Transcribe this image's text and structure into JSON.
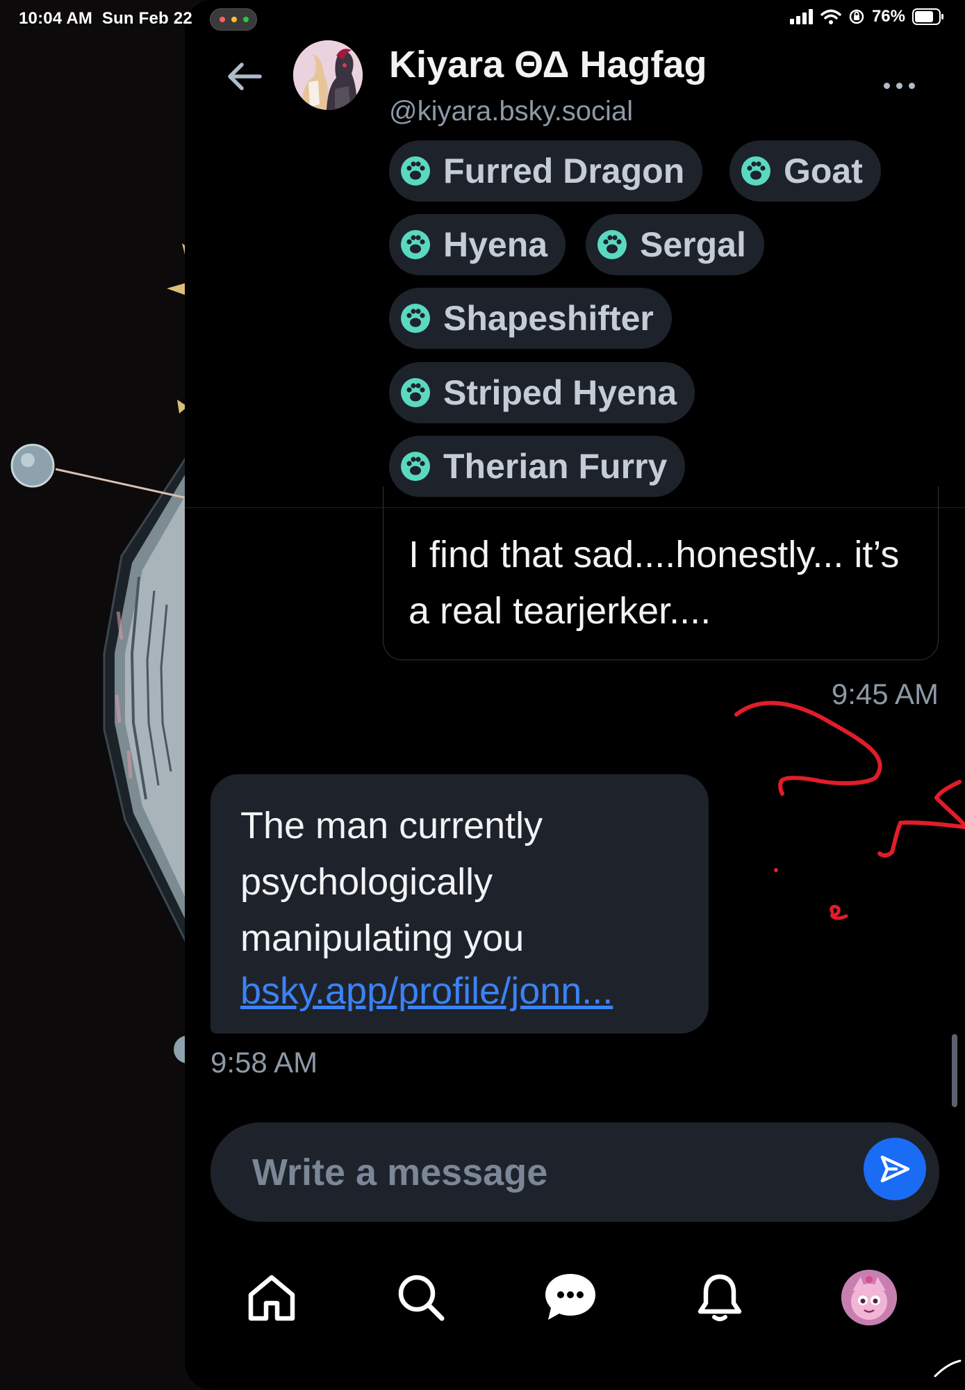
{
  "status_bar": {
    "time": "10:04 AM",
    "date": "Sun Feb 22",
    "battery": "76%"
  },
  "conversation": {
    "name": "Kiyara ΘΔ Hagfag",
    "handle": "@kiyara.bsky.social",
    "tags": [
      "Furred Dragon",
      "Goat",
      "Hyena",
      "Sergal",
      "Shapeshifter",
      "Striped Hyena",
      "Therian Furry"
    ]
  },
  "messages": {
    "sent": {
      "text": "I find that sad....honestly... it’s a real tearjerker....",
      "time": "9:45 AM"
    },
    "received": {
      "text": "The man currently psychologically manipulating you",
      "link": "bsky.app/profile/jonn...",
      "time": "9:58 AM"
    }
  },
  "composer": {
    "placeholder": "Write a message"
  },
  "colors": {
    "background": "#000000",
    "bubble": "#1e232b",
    "tag_icon": "#5ad9c1",
    "link": "#3b82f6",
    "send_button": "#1a6cf5",
    "annotation": "#e11d2a"
  },
  "icons": {
    "back": "arrow-left-icon",
    "more": "ellipsis-icon",
    "tag": "paw-icon",
    "send": "send-icon",
    "nav": [
      "home-icon",
      "search-icon",
      "chat-icon",
      "bell-icon",
      "profile-avatar"
    ]
  }
}
